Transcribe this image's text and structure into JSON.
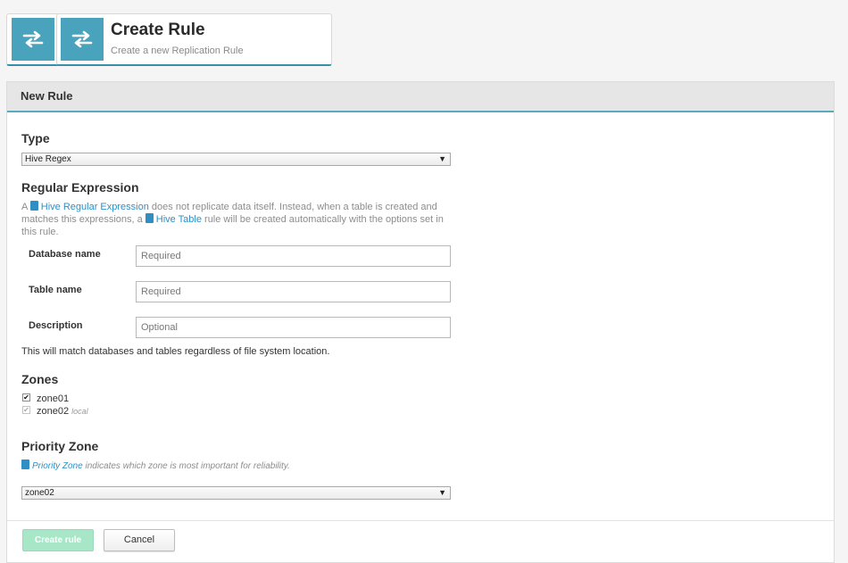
{
  "header": {
    "title": "Create Rule",
    "subtitle": "Create a new Replication Rule",
    "icon": "replication-arrows-icon"
  },
  "panel": {
    "title": "New Rule"
  },
  "form": {
    "type": {
      "label": "Type",
      "selected": "Hive Regex"
    },
    "regex": {
      "heading": "Regular Expression",
      "help_prefix": "A",
      "help_link1": "Hive Regular Expression",
      "help_mid1": "does not replicate data itself. Instead, when a table is created and matches this expressions, a",
      "help_link2": "Hive Table",
      "help_end": "rule will be created automatically with the options set in this rule."
    },
    "database": {
      "label": "Database name",
      "placeholder": "Required"
    },
    "table": {
      "label": "Table name",
      "placeholder": "Required"
    },
    "description": {
      "label": "Description",
      "placeholder": "Optional"
    },
    "match_note": "This will match databases and tables regardless of file system location.",
    "zones": {
      "heading": "Zones",
      "items": [
        {
          "name": "zone01",
          "tag": "",
          "checked": true,
          "disabled": false
        },
        {
          "name": "zone02",
          "tag": "local",
          "checked": true,
          "disabled": true
        }
      ]
    },
    "priority": {
      "heading": "Priority Zone",
      "help_link": "Priority Zone",
      "help_text": "indicates which zone is most important for reliability.",
      "selected": "zone02"
    }
  },
  "actions": {
    "create_label": "Create rule",
    "cancel_label": "Cancel"
  },
  "colors": {
    "accent": "#4aa3bd",
    "link": "#2f8fc4",
    "create_disabled": "#a8e6c8"
  }
}
